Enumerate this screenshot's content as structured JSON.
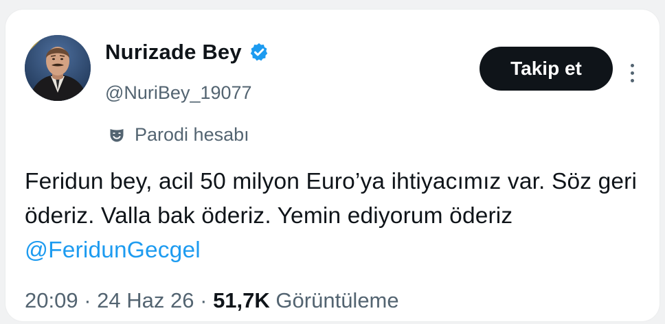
{
  "user": {
    "display_name": "Nurizade Bey",
    "handle": "@NuriBey_19077",
    "badge": "Parodi hesabı"
  },
  "follow_label": "Takip et",
  "tweet": {
    "text": "Feridun bey, acil 50 milyon Euro’ya ihtiyacımız var. Söz geri öderiz. Valla bak öderiz. Yemin ediyorum öderiz",
    "mention": "@FeridunGecgel"
  },
  "meta": {
    "time": "20:09",
    "separator": "·",
    "date": "24 Haz 26",
    "views_count": "51,7K",
    "views_label": "Görüntüleme"
  },
  "icons": {
    "verified": "verified-badge-icon",
    "parody": "parody-mask-icon",
    "more": "more-options-icon"
  },
  "colors": {
    "text": "#0f1419",
    "secondary": "#536471",
    "accent": "#1d9bf0",
    "button_bg": "#0f1419",
    "background": "#f1f2f3",
    "card": "#ffffff"
  }
}
